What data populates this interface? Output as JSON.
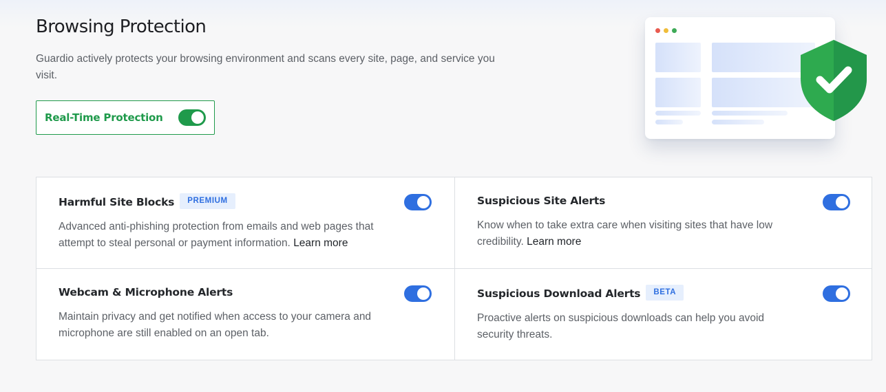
{
  "header": {
    "title": "Browsing Protection",
    "description": "Guardio actively protects your browsing environment and scans every site, page, and service you visit."
  },
  "realtime": {
    "label": "Real-Time Protection",
    "enabled": true,
    "color": "#1f9a4b"
  },
  "illustration": {
    "window_dots": [
      "#e95a4f",
      "#f0bd3a",
      "#3eaa57"
    ],
    "shield_icon": "shield-check-icon",
    "shield_color": "#2eaa4f"
  },
  "features": [
    {
      "title": "Harmful Site Blocks",
      "badge": "PREMIUM",
      "description": "Advanced anti-phishing protection from emails and web pages that attempt to steal personal or payment information.",
      "link": "Learn more",
      "enabled": true
    },
    {
      "title": "Suspicious Site Alerts",
      "badge": "",
      "description": "Know when to take extra care when visiting sites that have low credibility.",
      "link": "Learn more",
      "enabled": true
    },
    {
      "title": "Webcam & Microphone Alerts",
      "badge": "",
      "description": "Maintain privacy and get notified when access to your camera and microphone are still enabled on an open tab.",
      "link": "",
      "enabled": true
    },
    {
      "title": "Suspicious Download Alerts",
      "badge": "BETA",
      "description": "Proactive alerts on suspicious downloads can help you avoid security threats.",
      "link": "",
      "enabled": true
    }
  ],
  "colors": {
    "accent_blue": "#2f6fe0",
    "accent_green": "#1f9a4b",
    "badge_bg": "#e6effd"
  }
}
